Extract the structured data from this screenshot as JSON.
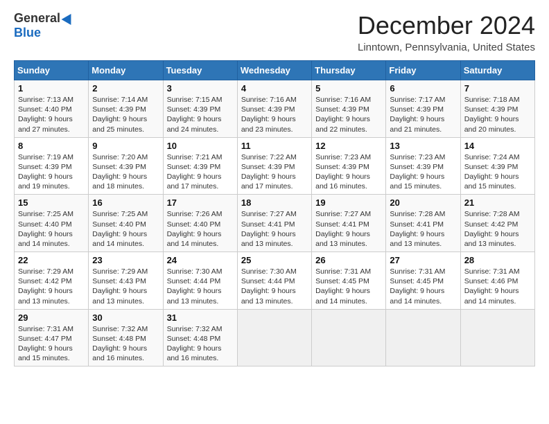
{
  "header": {
    "logo_general": "General",
    "logo_blue": "Blue",
    "month_title": "December 2024",
    "location": "Linntown, Pennsylvania, United States"
  },
  "weekdays": [
    "Sunday",
    "Monday",
    "Tuesday",
    "Wednesday",
    "Thursday",
    "Friday",
    "Saturday"
  ],
  "weeks": [
    [
      {
        "day": "1",
        "sunrise": "7:13 AM",
        "sunset": "4:40 PM",
        "daylight": "9 hours and 27 minutes."
      },
      {
        "day": "2",
        "sunrise": "7:14 AM",
        "sunset": "4:39 PM",
        "daylight": "9 hours and 25 minutes."
      },
      {
        "day": "3",
        "sunrise": "7:15 AM",
        "sunset": "4:39 PM",
        "daylight": "9 hours and 24 minutes."
      },
      {
        "day": "4",
        "sunrise": "7:16 AM",
        "sunset": "4:39 PM",
        "daylight": "9 hours and 23 minutes."
      },
      {
        "day": "5",
        "sunrise": "7:16 AM",
        "sunset": "4:39 PM",
        "daylight": "9 hours and 22 minutes."
      },
      {
        "day": "6",
        "sunrise": "7:17 AM",
        "sunset": "4:39 PM",
        "daylight": "9 hours and 21 minutes."
      },
      {
        "day": "7",
        "sunrise": "7:18 AM",
        "sunset": "4:39 PM",
        "daylight": "9 hours and 20 minutes."
      }
    ],
    [
      {
        "day": "8",
        "sunrise": "7:19 AM",
        "sunset": "4:39 PM",
        "daylight": "9 hours and 19 minutes."
      },
      {
        "day": "9",
        "sunrise": "7:20 AM",
        "sunset": "4:39 PM",
        "daylight": "9 hours and 18 minutes."
      },
      {
        "day": "10",
        "sunrise": "7:21 AM",
        "sunset": "4:39 PM",
        "daylight": "9 hours and 17 minutes."
      },
      {
        "day": "11",
        "sunrise": "7:22 AM",
        "sunset": "4:39 PM",
        "daylight": "9 hours and 17 minutes."
      },
      {
        "day": "12",
        "sunrise": "7:23 AM",
        "sunset": "4:39 PM",
        "daylight": "9 hours and 16 minutes."
      },
      {
        "day": "13",
        "sunrise": "7:23 AM",
        "sunset": "4:39 PM",
        "daylight": "9 hours and 15 minutes."
      },
      {
        "day": "14",
        "sunrise": "7:24 AM",
        "sunset": "4:39 PM",
        "daylight": "9 hours and 15 minutes."
      }
    ],
    [
      {
        "day": "15",
        "sunrise": "7:25 AM",
        "sunset": "4:40 PM",
        "daylight": "9 hours and 14 minutes."
      },
      {
        "day": "16",
        "sunrise": "7:25 AM",
        "sunset": "4:40 PM",
        "daylight": "9 hours and 14 minutes."
      },
      {
        "day": "17",
        "sunrise": "7:26 AM",
        "sunset": "4:40 PM",
        "daylight": "9 hours and 14 minutes."
      },
      {
        "day": "18",
        "sunrise": "7:27 AM",
        "sunset": "4:41 PM",
        "daylight": "9 hours and 13 minutes."
      },
      {
        "day": "19",
        "sunrise": "7:27 AM",
        "sunset": "4:41 PM",
        "daylight": "9 hours and 13 minutes."
      },
      {
        "day": "20",
        "sunrise": "7:28 AM",
        "sunset": "4:41 PM",
        "daylight": "9 hours and 13 minutes."
      },
      {
        "day": "21",
        "sunrise": "7:28 AM",
        "sunset": "4:42 PM",
        "daylight": "9 hours and 13 minutes."
      }
    ],
    [
      {
        "day": "22",
        "sunrise": "7:29 AM",
        "sunset": "4:42 PM",
        "daylight": "9 hours and 13 minutes."
      },
      {
        "day": "23",
        "sunrise": "7:29 AM",
        "sunset": "4:43 PM",
        "daylight": "9 hours and 13 minutes."
      },
      {
        "day": "24",
        "sunrise": "7:30 AM",
        "sunset": "4:44 PM",
        "daylight": "9 hours and 13 minutes."
      },
      {
        "day": "25",
        "sunrise": "7:30 AM",
        "sunset": "4:44 PM",
        "daylight": "9 hours and 13 minutes."
      },
      {
        "day": "26",
        "sunrise": "7:31 AM",
        "sunset": "4:45 PM",
        "daylight": "9 hours and 14 minutes."
      },
      {
        "day": "27",
        "sunrise": "7:31 AM",
        "sunset": "4:45 PM",
        "daylight": "9 hours and 14 minutes."
      },
      {
        "day": "28",
        "sunrise": "7:31 AM",
        "sunset": "4:46 PM",
        "daylight": "9 hours and 14 minutes."
      }
    ],
    [
      {
        "day": "29",
        "sunrise": "7:31 AM",
        "sunset": "4:47 PM",
        "daylight": "9 hours and 15 minutes."
      },
      {
        "day": "30",
        "sunrise": "7:32 AM",
        "sunset": "4:48 PM",
        "daylight": "9 hours and 16 minutes."
      },
      {
        "day": "31",
        "sunrise": "7:32 AM",
        "sunset": "4:48 PM",
        "daylight": "9 hours and 16 minutes."
      },
      null,
      null,
      null,
      null
    ]
  ],
  "labels": {
    "sunrise": "Sunrise:",
    "sunset": "Sunset:",
    "daylight": "Daylight:"
  }
}
